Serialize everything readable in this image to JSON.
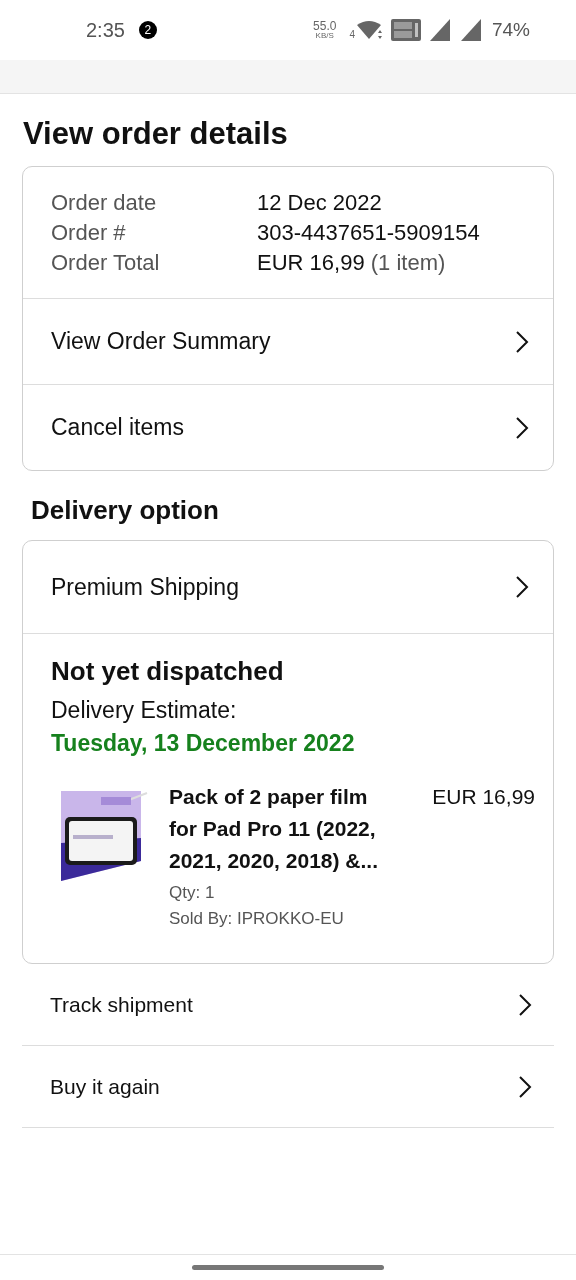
{
  "status_bar": {
    "time": "2:35",
    "notification_count": "2",
    "net_speed": "55.0",
    "net_unit": "KB/S",
    "wifi_label": "4",
    "battery": "74%"
  },
  "title": "View order details",
  "order_info": [
    {
      "label": "Order date",
      "value": "12 Dec 2022"
    },
    {
      "label": "Order #",
      "value": "303-4437651-5909154"
    },
    {
      "label": "Order Total",
      "value": "EUR 16,99",
      "note": "(1 item)"
    }
  ],
  "order_links": [
    "View Order Summary",
    "Cancel items"
  ],
  "delivery": {
    "heading": "Delivery option",
    "shipping": "Premium Shipping",
    "status": "Not yet dispatched",
    "estimate_label": "Delivery Estimate:",
    "estimate_date": "Tuesday, 13 December 2022",
    "item": {
      "title": "Pack of 2 paper film for Pad Pro 11 (2022, 2021, 2020, 2018) &...",
      "price": "EUR 16,99",
      "qty": "Qty: 1",
      "seller": "Sold By: IPROKKO-EU"
    }
  },
  "actions": [
    "Track shipment",
    "Buy it again"
  ]
}
